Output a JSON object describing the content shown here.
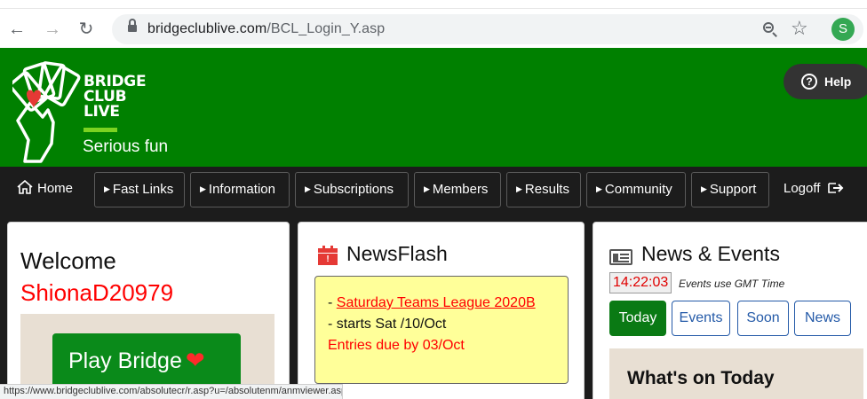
{
  "browser": {
    "url_domain": "bridgeclublive.com",
    "url_path": "/BCL_Login_Y.asp",
    "profile_initial": "S",
    "status_url": "https://www.bridgeclublive.com/absolutecr/r.asp?u=/absolutenm/anmviewer.asp?a=2251"
  },
  "header": {
    "brand_line1": "BRIDGE",
    "brand_line2": "CLUB",
    "brand_line3": "LIVE",
    "tagline": "Serious fun",
    "help_label": "Help",
    "brand_color": "#008000"
  },
  "menu": {
    "items": [
      {
        "label": "Home"
      },
      {
        "label": "Fast Links"
      },
      {
        "label": "Information"
      },
      {
        "label": "Subscriptions"
      },
      {
        "label": "Members"
      },
      {
        "label": "Results"
      },
      {
        "label": "Community"
      },
      {
        "label": "Support"
      },
      {
        "label": "Logoff"
      }
    ]
  },
  "welcome": {
    "title": "Welcome",
    "username": "ShionaD20979",
    "play_label": "Play Bridge"
  },
  "newsflash": {
    "title": "NewsFlash",
    "dash": "- ",
    "link_text": "Saturday Teams League 2020B",
    "line2": "- starts Sat /10/Oct",
    "line3": "Entries due by 03/Oct"
  },
  "news_events": {
    "title": "News & Events",
    "time": "14:22:03",
    "time_note": "Events use GMT Time",
    "tabs": [
      {
        "label": "Today",
        "active": true
      },
      {
        "label": "Events",
        "active": false
      },
      {
        "label": "Soon",
        "active": false
      },
      {
        "label": "News",
        "active": false
      }
    ],
    "whats_on_title": "What's on Today"
  }
}
